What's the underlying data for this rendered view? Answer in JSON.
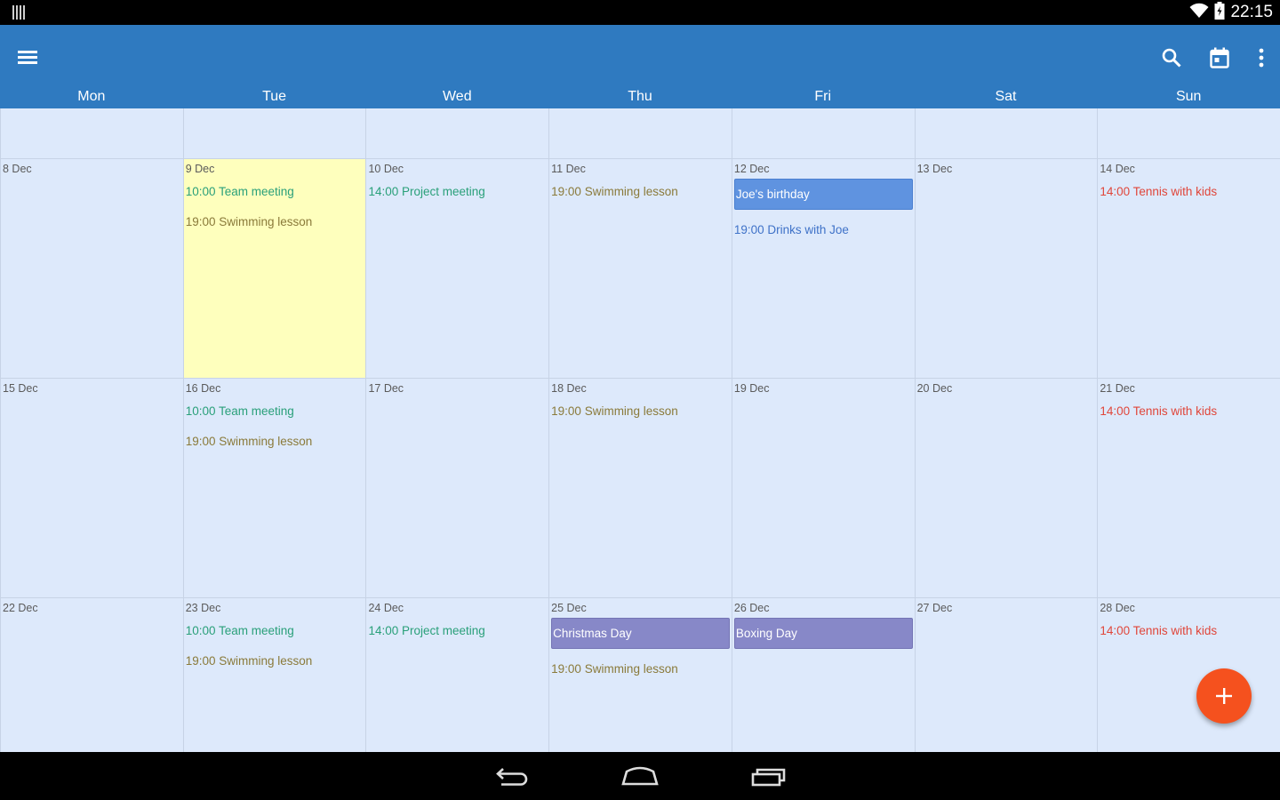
{
  "status_bar": {
    "time": "22:15",
    "icons": [
      "notification-icon",
      "wifi-icon",
      "battery-icon"
    ]
  },
  "app_bar": {
    "icons": [
      "menu-icon",
      "search-icon",
      "calendar-today-icon",
      "more-vert-icon"
    ],
    "day_names": [
      "Mon",
      "Tue",
      "Wed",
      "Thu",
      "Fri",
      "Sat",
      "Sun"
    ]
  },
  "weeks": [
    {
      "days": [
        {
          "date": "",
          "events": []
        },
        {
          "date": "",
          "events": []
        },
        {
          "date": "",
          "events": []
        },
        {
          "date": "",
          "events": []
        },
        {
          "date": "",
          "events": []
        },
        {
          "date": "",
          "events": []
        },
        {
          "date": "",
          "events": []
        }
      ]
    },
    {
      "days": [
        {
          "date": "8 Dec",
          "events": []
        },
        {
          "date": "9 Dec",
          "today": true,
          "events": [
            {
              "text": "10:00 Team meeting",
              "color": "green"
            },
            {
              "text": "19:00 Swimming lesson",
              "color": "olive"
            }
          ]
        },
        {
          "date": "10 Dec",
          "events": [
            {
              "text": "14:00 Project meeting",
              "color": "green"
            }
          ]
        },
        {
          "date": "11 Dec",
          "events": [
            {
              "text": "19:00 Swimming lesson",
              "color": "olive"
            }
          ]
        },
        {
          "date": "12 Dec",
          "events": [
            {
              "text": "Joe's birthday",
              "block": "birthday"
            },
            {
              "text": "19:00 Drinks with Joe",
              "color": "blue"
            }
          ]
        },
        {
          "date": "13 Dec",
          "events": []
        },
        {
          "date": "14 Dec",
          "events": [
            {
              "text": "14:00 Tennis with kids",
              "color": "red"
            }
          ]
        }
      ]
    },
    {
      "days": [
        {
          "date": "15 Dec",
          "events": []
        },
        {
          "date": "16 Dec",
          "events": [
            {
              "text": "10:00 Team meeting",
              "color": "green"
            },
            {
              "text": "19:00 Swimming lesson",
              "color": "olive"
            }
          ]
        },
        {
          "date": "17 Dec",
          "events": []
        },
        {
          "date": "18 Dec",
          "events": [
            {
              "text": "19:00 Swimming lesson",
              "color": "olive"
            }
          ]
        },
        {
          "date": "19 Dec",
          "events": []
        },
        {
          "date": "20 Dec",
          "events": []
        },
        {
          "date": "21 Dec",
          "events": [
            {
              "text": "14:00 Tennis with kids",
              "color": "red"
            }
          ]
        }
      ]
    },
    {
      "days": [
        {
          "date": "22 Dec",
          "events": []
        },
        {
          "date": "23 Dec",
          "events": [
            {
              "text": "10:00 Team meeting",
              "color": "green"
            },
            {
              "text": "19:00 Swimming lesson",
              "color": "olive"
            }
          ]
        },
        {
          "date": "24 Dec",
          "events": [
            {
              "text": "14:00 Project meeting",
              "color": "green"
            }
          ]
        },
        {
          "date": "25 Dec",
          "events": [
            {
              "text": "Christmas Day",
              "block": "holiday"
            },
            {
              "text": "19:00 Swimming lesson",
              "color": "olive"
            }
          ]
        },
        {
          "date": "26 Dec",
          "events": [
            {
              "text": "Boxing Day",
              "block": "holiday"
            }
          ]
        },
        {
          "date": "27 Dec",
          "events": []
        },
        {
          "date": "28 Dec",
          "events": [
            {
              "text": "14:00 Tennis with kids",
              "color": "red"
            }
          ]
        }
      ]
    }
  ],
  "fab": {
    "icon": "add-icon"
  },
  "nav_bar": {
    "icons": [
      "back-icon",
      "home-icon",
      "recents-icon"
    ]
  },
  "colors": {
    "app_bar": "#2f7ac0",
    "grid_background": "#dde9fb",
    "today_background": "#feffbd",
    "fab": "#f5511e",
    "event_green": "#2aa07a",
    "event_olive": "#8a7a3a",
    "event_red": "#e0463a",
    "event_blue": "#3f72c8",
    "birthday_block": "#5f93e0",
    "holiday_block": "#8788c8"
  }
}
